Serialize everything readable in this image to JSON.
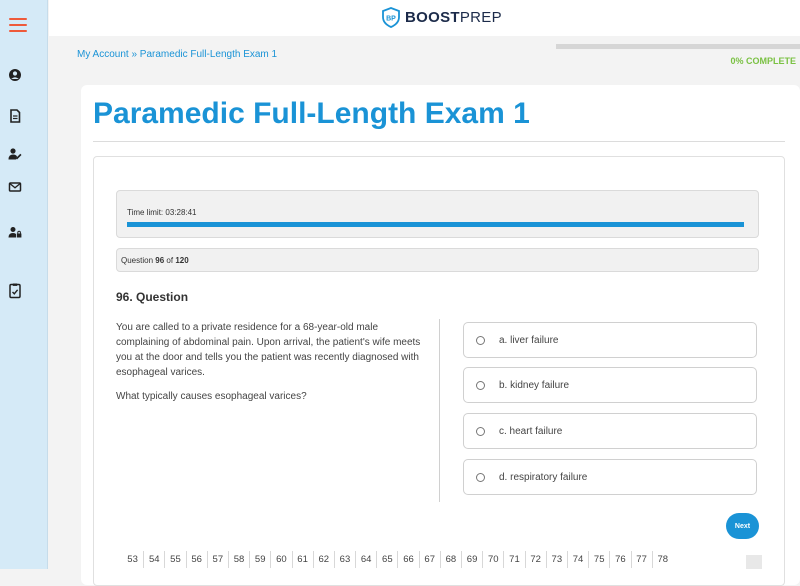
{
  "sidebar": {
    "items": [
      {
        "icon": "menu-icon"
      },
      {
        "icon": "user-icon"
      },
      {
        "icon": "document-icon"
      },
      {
        "icon": "user-edit-icon"
      },
      {
        "icon": "envelope-icon"
      },
      {
        "icon": "user-lock-icon"
      },
      {
        "icon": "exam-icon"
      }
    ],
    "menu_color": "#ee5a3a"
  },
  "header": {
    "logo_bold": "BOOST",
    "logo_light": "PREP"
  },
  "breadcrumb": "My Account » Paramedic Full-Length Exam 1",
  "progress": {
    "label": "0% COMPLETE",
    "value": 0,
    "color": "#7ac143"
  },
  "exam": {
    "title": "Paramedic Full-Length Exam 1",
    "time_limit_label": "Time limit: 03:28:41",
    "question_counter": {
      "prefix": "Question",
      "current": "96",
      "middle": "of",
      "total": "120"
    },
    "question_heading": "96. Question",
    "question_paragraphs": [
      "You are called to a private residence for a 68-year-old male complaining of abdominal pain. Upon arrival, the patient's wife meets you at the door and tells you the patient was recently diagnosed with esophageal varices.",
      "What typically causes esophageal varices?"
    ],
    "answers": [
      "a. liver failure",
      "b. kidney failure",
      "c. heart failure",
      "d. respiratory failure"
    ],
    "next_label": "Next",
    "nav_numbers": [
      "53",
      "54",
      "55",
      "56",
      "57",
      "58",
      "59",
      "60",
      "61",
      "62",
      "63",
      "64",
      "65",
      "66",
      "67",
      "68",
      "69",
      "70",
      "71",
      "72",
      "73",
      "74",
      "75",
      "76",
      "77",
      "78"
    ],
    "accent_color": "#1a93d6"
  }
}
